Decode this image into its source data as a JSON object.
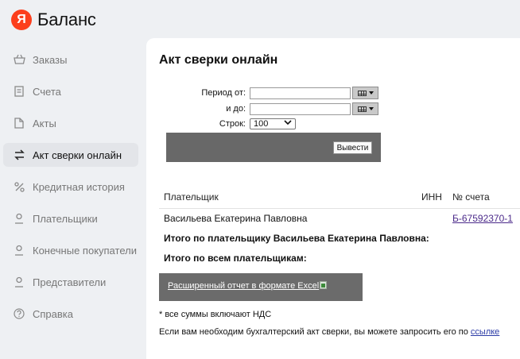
{
  "brand": {
    "logo_letter": "Я",
    "name": "Баланс",
    "logo_color": "#fc3f1d"
  },
  "sidebar": {
    "items": [
      {
        "label": "Заказы",
        "icon": "basket-icon"
      },
      {
        "label": "Счета",
        "icon": "invoice-icon"
      },
      {
        "label": "Акты",
        "icon": "document-icon"
      },
      {
        "label": "Акт сверки онлайн",
        "icon": "swap-arrows-icon",
        "active": true
      },
      {
        "label": "Кредитная история",
        "icon": "percent-icon"
      },
      {
        "label": "Плательщики",
        "icon": "person-icon"
      },
      {
        "label": "Конечные покупатели",
        "icon": "person-icon"
      },
      {
        "label": "Представители",
        "icon": "person-icon"
      },
      {
        "label": "Справка",
        "icon": "question-icon"
      }
    ]
  },
  "main": {
    "title": "Акт сверки онлайн",
    "form": {
      "period_from_label": "Период от:",
      "period_from_value": "",
      "period_to_label": "и до:",
      "period_to_value": "",
      "rows_label": "Строк:",
      "rows_value": "100",
      "submit_label": "Вывести"
    },
    "table": {
      "headers": {
        "payer": "Плательщик",
        "inn": "ИНН",
        "account": "№ счета"
      },
      "row": {
        "payer": "Васильева Екатерина Павловна",
        "inn": "",
        "account": "Б-67592370-1"
      },
      "subtotal_label": "Итого по плательщику Васильева Екатерина Павловна:",
      "total_label": "Итого по всем плательщикам:"
    },
    "excel_link": "Расширенный отчет в формате Excel",
    "vat_note": "* все суммы включают НДС",
    "request_note": "Если вам необходим бухгалтерский акт сверки, вы можете запросить его по",
    "request_link": "ссылке"
  }
}
